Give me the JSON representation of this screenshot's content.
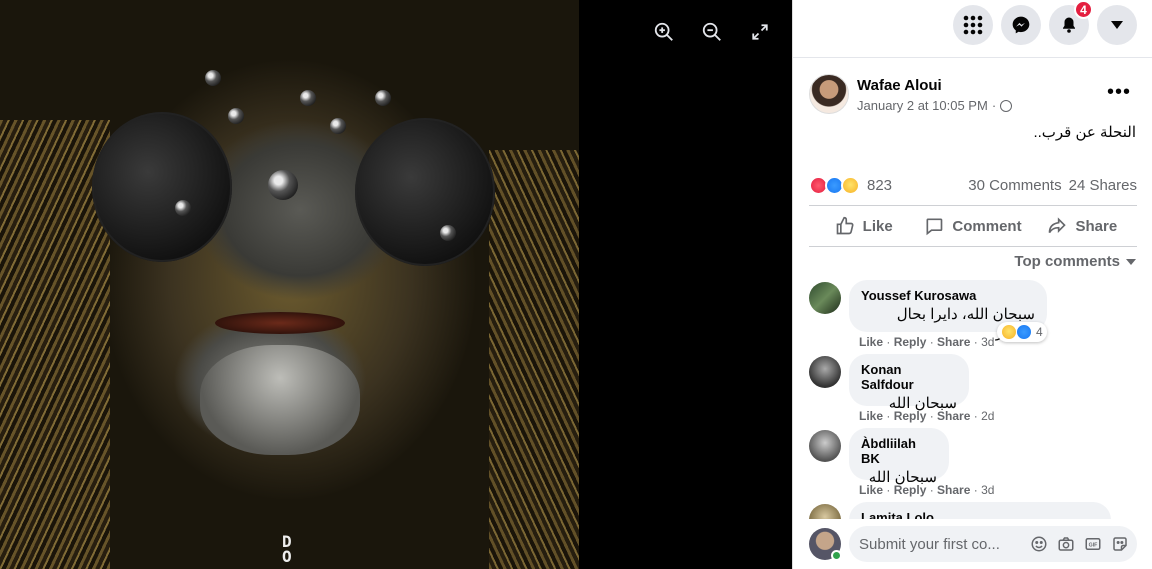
{
  "viewer": {
    "watermark": "D\nO",
    "tools": [
      {
        "icon": "zoom-in-icon"
      },
      {
        "icon": "zoom-out-icon"
      },
      {
        "icon": "fullscreen-icon"
      }
    ]
  },
  "topbar": {
    "notifications_badge": "4",
    "icons": [
      "menu-grid-icon",
      "messenger-icon",
      "bell-icon",
      "account-caret-icon"
    ]
  },
  "post": {
    "author": "Wafae Aloui",
    "timestamp": "January 2 at 10:05 PM",
    "separator": "·",
    "privacy_icon": "globe-icon",
    "text": "النحلة عن قرب..",
    "reactions": {
      "types": [
        "love",
        "like",
        "wow"
      ],
      "count": "823"
    },
    "comments_count": "30 Comments",
    "shares_count": "24 Shares",
    "actions": {
      "like": "Like",
      "comment": "Comment",
      "share": "Share"
    },
    "sort_label": "Top comments"
  },
  "comments": [
    {
      "name": "Youssef Kurosawa",
      "text": "سبحان الله، دايرا بحال فرايزر",
      "links": [
        "Like",
        "Reply",
        "Share"
      ],
      "age": "3d",
      "reactions": {
        "types": [
          "haha",
          "like"
        ],
        "count": "4"
      }
    },
    {
      "name": "Konan Salfdour",
      "text": "سبحان الله",
      "links": [
        "Like",
        "Reply",
        "Share"
      ],
      "age": "2d"
    },
    {
      "name": "Àbdliilah BK",
      "text": "سبحان الله",
      "links": [
        "Like",
        "Reply",
        "Share"
      ],
      "age": "3d"
    },
    {
      "name": "Lamita Lolo",
      "text": "",
      "links": [],
      "age": ""
    }
  ],
  "composer": {
    "placeholder": "Submit your first co...",
    "icons": [
      "emoji-icon",
      "camera-icon",
      "gif-icon",
      "sticker-icon"
    ]
  },
  "colors": {
    "accent": "#1877f2",
    "badge": "#e41e3f",
    "secondary_text": "#65676b",
    "bubble_bg": "#f0f2f5",
    "online": "#31a24c"
  }
}
